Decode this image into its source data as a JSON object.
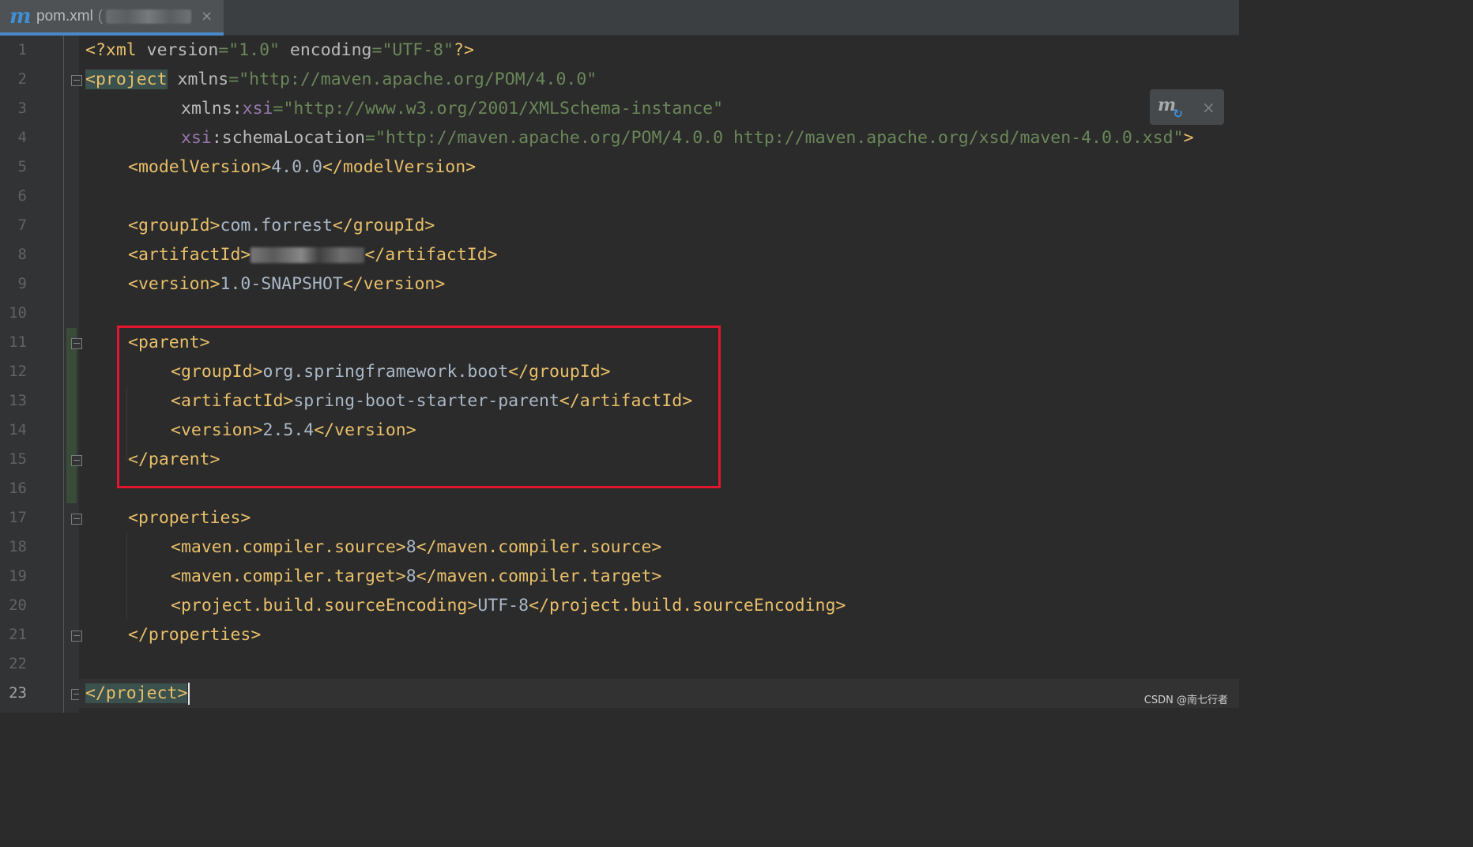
{
  "tab": {
    "icon_letter": "m",
    "label": "pom.xml",
    "paren": "(",
    "close_glyph": "×"
  },
  "gutter": {
    "line_numbers": [
      "1",
      "2",
      "3",
      "4",
      "5",
      "6",
      "7",
      "8",
      "9",
      "10",
      "11",
      "12",
      "13",
      "14",
      "15",
      "16",
      "17",
      "18",
      "19",
      "20",
      "21",
      "22",
      "23"
    ],
    "current_line": 23
  },
  "code": {
    "line1": {
      "decl_open": "<?xml ",
      "version_attr": "version",
      "eq": "=",
      "version_val": "\"1.0\"",
      "sp": " ",
      "enc_attr": "encoding",
      "enc_val": "\"UTF-8\"",
      "decl_close": "?>"
    },
    "line2": {
      "open": "<project",
      "sp": " ",
      "attr": "xmlns",
      "eq": "=",
      "val": "\"http://maven.apache.org/POM/4.0.0\""
    },
    "line3": {
      "attr": "xmlns:",
      "ns": "xsi",
      "eq": "=",
      "val": "\"http://www.w3.org/2001/XMLSchema-instance\""
    },
    "line4": {
      "ns": "xsi",
      "attr": ":schemaLocation",
      "eq": "=",
      "val": "\"http://maven.apache.org/POM/4.0.0 http://maven.apache.org/xsd/maven-4.0.0.xsd\"",
      "close": ">"
    },
    "line5": {
      "open": "<modelVersion>",
      "text": "4.0.0",
      "close": "</modelVersion>"
    },
    "line7": {
      "open": "<groupId>",
      "text": "com.forrest",
      "close": "</groupId>"
    },
    "line8": {
      "open": "<artifactId>",
      "close": "</artifactId>"
    },
    "line9": {
      "open": "<version>",
      "text": "1.0-SNAPSHOT",
      "close": "</version>"
    },
    "line11": {
      "open": "<parent>"
    },
    "line12": {
      "open": "<groupId>",
      "text": "org.springframework.boot",
      "close": "</groupId>"
    },
    "line13": {
      "open": "<artifactId>",
      "text": "spring-boot-starter-parent",
      "close": "</artifactId>"
    },
    "line14": {
      "open": "<version>",
      "text": "2.5.4",
      "close": "</version>"
    },
    "line15": {
      "close": "</parent>"
    },
    "line17": {
      "open": "<properties>"
    },
    "line18": {
      "open": "<maven.compiler.source>",
      "text": "8",
      "close": "</maven.compiler.source>"
    },
    "line19": {
      "open": "<maven.compiler.target>",
      "text": "8",
      "close": "</maven.compiler.target>"
    },
    "line20": {
      "open": "<project.build.sourceEncoding>",
      "text": "UTF-8",
      "close": "</project.build.sourceEncoding>"
    },
    "line21": {
      "close": "</properties>"
    },
    "line23": {
      "close": "</project>"
    }
  },
  "maven_popup": {
    "icon_letter": "m",
    "reload_glyph": "↻",
    "close_glyph": "×"
  },
  "watermark": "CSDN @南七行者",
  "colors": {
    "background": "#2b2b2b",
    "tag": "#e8bf6a",
    "attribute": "#bababa",
    "namespace": "#9876aa",
    "string": "#6a8759",
    "text": "#a9b7c6",
    "annotation_box": "#e3152f",
    "active_tab_underline": "#4a88c7"
  },
  "icons": {
    "tab_icon": "maven-file-icon",
    "popup_icon": "maven-reload-icon",
    "close": "close-icon"
  }
}
